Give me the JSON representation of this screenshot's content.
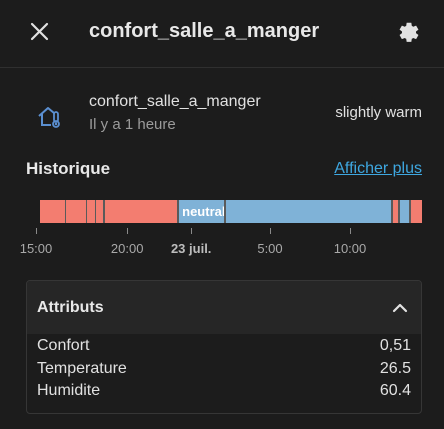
{
  "header": {
    "title": "confort_salle_a_manger",
    "close_icon": "close-icon",
    "settings_icon": "gear-icon"
  },
  "entity": {
    "icon": "home-thermometer-icon",
    "name": "confort_salle_a_manger",
    "last_changed": "Il y a 1 heure",
    "state": "slightly warm"
  },
  "history": {
    "title": "Historique",
    "show_more": "Afficher plus",
    "colors": {
      "slightly_warm": "#f37d70",
      "neutral": "#7fb2d7",
      "separator": "#5a5a5a"
    },
    "segments": [
      {
        "state": "slightly warm",
        "start": 0.0,
        "end": 0.359
      },
      {
        "state": "neutral",
        "start": 0.359,
        "end": 0.92,
        "label": "neutral"
      },
      {
        "state": "slightly warm",
        "start": 0.92,
        "end": 0.938
      },
      {
        "state": "neutral",
        "start": 0.938,
        "end": 0.966
      },
      {
        "state": "slightly warm",
        "start": 0.966,
        "end": 1.0
      }
    ],
    "separators": [
      0.065,
      0.12,
      0.143,
      0.165,
      0.359,
      0.482,
      0.92,
      0.938,
      0.966
    ],
    "axis": [
      {
        "label": "15:00",
        "pos": 0.025,
        "bold": false
      },
      {
        "label": "20:00",
        "pos": 0.253,
        "bold": false
      },
      {
        "label": "23 juil.",
        "pos": 0.413,
        "bold": true
      },
      {
        "label": "5:00",
        "pos": 0.61,
        "bold": false
      },
      {
        "label": "10:00",
        "pos": 0.81,
        "bold": false
      }
    ]
  },
  "attributes": {
    "title": "Attributs",
    "expanded": true,
    "chevron_icon": "chevron-up-icon",
    "rows": [
      {
        "key": "Confort",
        "value": "0,51"
      },
      {
        "key": "Temperature",
        "value": "26.5"
      },
      {
        "key": "Humidite",
        "value": "60.4"
      }
    ]
  }
}
